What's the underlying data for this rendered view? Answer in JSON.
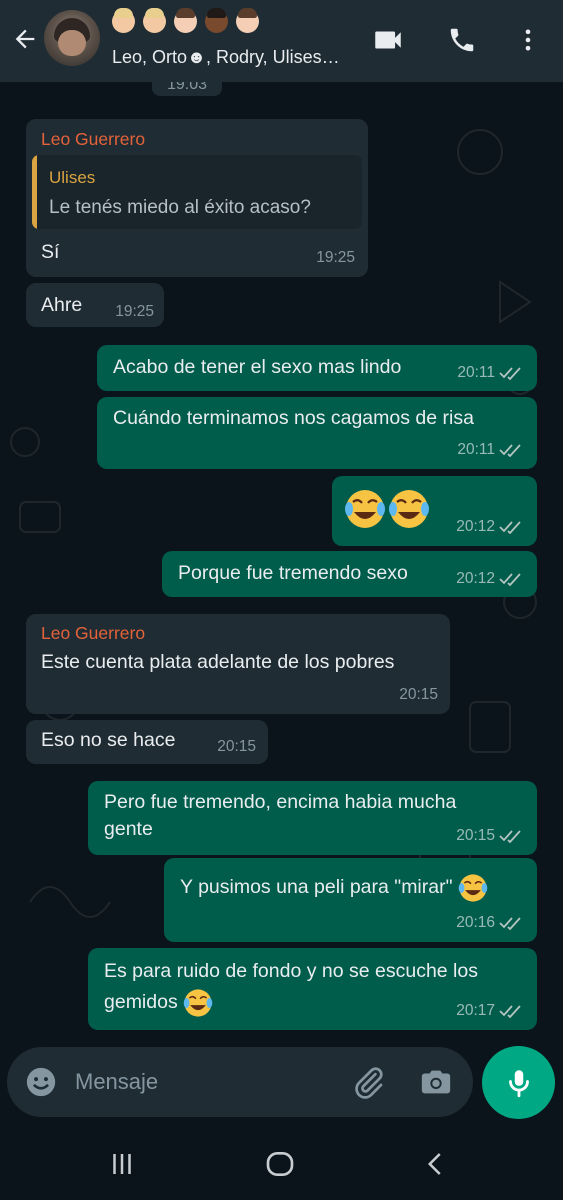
{
  "header": {
    "group_names": "Leo, Orto☻, Rodry, Ulises…",
    "icons": [
      "back-arrow-icon",
      "video-call-icon",
      "voice-call-icon",
      "more-vertical-icon"
    ]
  },
  "chat": {
    "top_time": "19:03",
    "messages": [
      {
        "dir": "in",
        "sender": "Leo Guerrero",
        "quote_name": "Ulises",
        "quote_text": "Le tenés miedo al éxito acaso?",
        "text": "Sí",
        "time": "19:25"
      },
      {
        "dir": "in",
        "text": "Ahre",
        "time": "19:25"
      },
      {
        "dir": "out",
        "text": "Acabo de tener el sexo mas lindo",
        "time": "20:11"
      },
      {
        "dir": "out",
        "text": "Cuándo terminamos nos cagamos de risa",
        "time": "20:11"
      },
      {
        "dir": "out",
        "text": "",
        "emojis": "😂😂",
        "time": "20:12"
      },
      {
        "dir": "out",
        "text": "Porque fue tremendo sexo",
        "time": "20:12"
      },
      {
        "dir": "in",
        "sender": "Leo Guerrero",
        "text": "Este cuenta plata adelante de los pobres",
        "time": "20:15"
      },
      {
        "dir": "in",
        "text": "Eso no se hace",
        "time": "20:15"
      },
      {
        "dir": "out",
        "text_line1": "Pero fue tremendo, encima habia mucha",
        "text_line2": "gente",
        "time": "20:15"
      },
      {
        "dir": "out",
        "text": "Y pusimos una peli para \"mirar\"",
        "emoji": "😂",
        "time": "20:16"
      },
      {
        "dir": "out",
        "text_line1": "Es para ruido de fondo y no se escuche los",
        "text_line2": "gemidos",
        "emoji": "😂",
        "time": "20:17"
      }
    ]
  },
  "composer": {
    "placeholder": "Mensaje",
    "icons": [
      "emoji-icon",
      "attach-icon",
      "camera-icon",
      "mic-icon"
    ]
  },
  "colors": {
    "background": "#0b141a",
    "header": "#1f2c34",
    "incoming": "#202c33",
    "outgoing": "#005c4b",
    "sender": "#e4623a",
    "quote_accent": "#d9a441",
    "accent": "#00a884"
  }
}
